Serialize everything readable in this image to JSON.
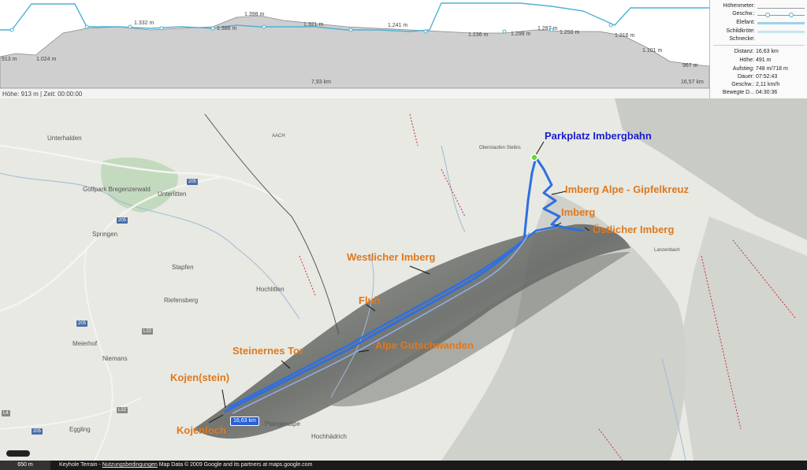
{
  "profile": {
    "elevation_labels": [
      "913 m",
      "1.024 m",
      "1.332 m",
      "1.386 m",
      "1.398 m",
      "1.321 m",
      "1.241 m",
      "1.236 m",
      "1.299 m",
      "1.287 m",
      "1.250 m",
      "1.216 m",
      "1.101 m",
      "967 m"
    ],
    "distance_labels": [
      "7,93 km",
      "16,57 km"
    ],
    "status": "Höhe: 913 m | Zeit: 00:00:00"
  },
  "legend": {
    "items": [
      {
        "label": "Höhenmeter:",
        "color": ""
      },
      {
        "label": "Geschw.:",
        "color": "#4fb0d6"
      },
      {
        "label": "Elefant:",
        "color": "#9ed2ea"
      },
      {
        "label": "Schildkröte:",
        "color": "#c7e4f1"
      },
      {
        "label": "Schnecke:",
        "color": ""
      }
    ]
  },
  "stats": [
    {
      "key": "Distanz:",
      "value": "16,63 km"
    },
    {
      "key": "Höhe:",
      "value": "491 m"
    },
    {
      "key": "Aufstieg:",
      "value": "748 m/718 m"
    },
    {
      "key": "Dauer:",
      "value": "07:52:43"
    },
    {
      "key": "Geschw.:",
      "value": "2,11 km/h"
    },
    {
      "key": "Bewegte D...",
      "value": "04:30:36"
    }
  ],
  "map": {
    "annotations": [
      {
        "text": "Parkplatz Imbergbahn"
      },
      {
        "text": "Imberg Alpe - Gipfelkreuz"
      },
      {
        "text": "Imberg"
      },
      {
        "text": "Östlicher Imberg"
      },
      {
        "text": "Westlicher Imberg"
      },
      {
        "text": "Fluh"
      },
      {
        "text": "Alpe Gutschwanden"
      },
      {
        "text": "Steinernes Tor"
      },
      {
        "text": "Kojen(stein)"
      },
      {
        "text": "Kojenloch"
      }
    ],
    "places": [
      "Unterhalden",
      "Golfpark Bregenzerwald",
      "Unterlitten",
      "Springen",
      "Stapfen",
      "Hochlitten",
      "Riefensberg",
      "Meierhof",
      "Niemans",
      "Eggling",
      "Hochhädrich",
      "Ptangenalpe",
      "AACH",
      "Lanzenbach",
      "Oberstaufen Steibis"
    ],
    "road_numbers": [
      "205",
      "205",
      "205",
      "205",
      "L22",
      "L22",
      "L4"
    ],
    "distance_badge": "16,63 km"
  },
  "footer": {
    "scale": "650 m",
    "terrain": "Keyhole Terrain - ",
    "terms_link": "Nutzungsbedingungen",
    "attribution": " Map Data © 2009 Google and its partners at maps.google.com"
  },
  "colors": {
    "track": "#2f6fe0",
    "annotation": "#e0781e",
    "annotation_start": "#1b1bd0",
    "profile_fill": "#cfcfcf",
    "speed_line": "#4fb0d6"
  }
}
